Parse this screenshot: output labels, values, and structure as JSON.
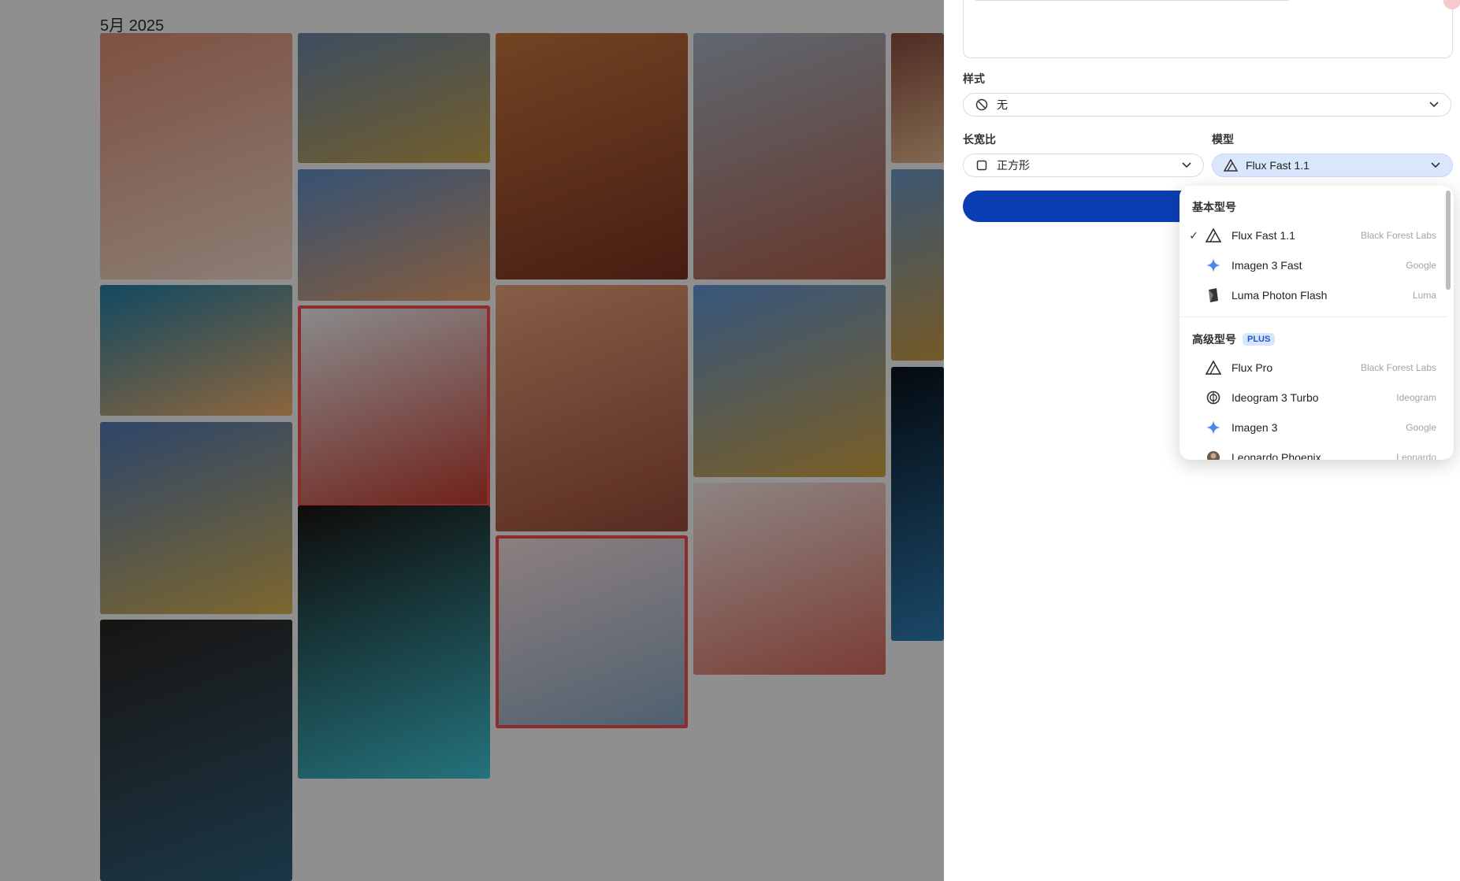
{
  "gallery": {
    "month_label": "5月 2025",
    "images": [
      {
        "id": "silk-passport",
        "colors": [
          "#d98c73",
          "#f0d9c8"
        ],
        "selected": false
      },
      {
        "id": "coastal-cliffs",
        "colors": [
          "#6a86a6",
          "#c6a34e"
        ],
        "selected": false
      },
      {
        "id": "red-train",
        "colors": [
          "#c5763d",
          "#7a3221"
        ],
        "selected": false
      },
      {
        "id": "church-street",
        "colors": [
          "#a4b3c2",
          "#b05e49"
        ],
        "selected": false
      },
      {
        "id": "pagoda-edge",
        "colors": [
          "#8a4b3f",
          "#e0b68a"
        ],
        "selected": false
      },
      {
        "id": "beach-sunset",
        "colors": [
          "#5d8ec6",
          "#e6a06b"
        ],
        "selected": false
      },
      {
        "id": "coral-reef",
        "colors": [
          "#1f7ea8",
          "#f2b06a"
        ],
        "selected": false
      },
      {
        "id": "portrait-woman-1",
        "colors": [
          "#eef1f4",
          "#c0392b"
        ],
        "selected": true
      },
      {
        "id": "eiffel-canyon",
        "colors": [
          "#e8a27a",
          "#9a4b3a"
        ],
        "selected": false
      },
      {
        "id": "savanna-sky",
        "colors": [
          "#5f95d6",
          "#d2a441"
        ],
        "selected": false
      },
      {
        "id": "field-hills",
        "colors": [
          "#4f79b6",
          "#d7b250"
        ],
        "selected": false
      },
      {
        "id": "portrait-woman-2",
        "colors": [
          "#f4dcdc",
          "#88a6c0"
        ],
        "selected": true
      },
      {
        "id": "portrait-woman-3",
        "colors": [
          "#f3e5e2",
          "#d46a5c"
        ],
        "selected": false
      },
      {
        "id": "ai-hologram",
        "colors": [
          "#1a1512",
          "#3fc6d6"
        ],
        "selected": false
      },
      {
        "id": "businessman",
        "colors": [
          "#2a2420",
          "#2f5f7a"
        ],
        "selected": false
      },
      {
        "id": "landscape-edge",
        "colors": [
          "#6a96c4",
          "#c89b45"
        ],
        "selected": false
      },
      {
        "id": "dark-blue-glow",
        "colors": [
          "#08121c",
          "#2e7db4"
        ],
        "selected": false
      }
    ]
  },
  "panel": {
    "style_label": "样式",
    "style_value": "无",
    "aspect_label": "长宽比",
    "aspect_value": "正方形",
    "model_label": "模型",
    "model_value": "Flux Fast 1.1"
  },
  "dropdown": {
    "basic_heading": "基本型号",
    "advanced_heading": "高级型号",
    "plus_badge": "PLUS",
    "basic_options": [
      {
        "name": "Flux Fast 1.1",
        "provider": "Black Forest Labs",
        "icon": "flux-icon",
        "checked": true
      },
      {
        "name": "Imagen 3 Fast",
        "provider": "Google",
        "icon": "imagen-sparkle-icon",
        "checked": false
      },
      {
        "name": "Luma Photon Flash",
        "provider": "Luma",
        "icon": "luma-icon",
        "checked": false
      }
    ],
    "advanced_options": [
      {
        "name": "Flux Pro",
        "provider": "Black Forest Labs",
        "icon": "flux-icon"
      },
      {
        "name": "Ideogram 3 Turbo",
        "provider": "Ideogram",
        "icon": "ideogram-icon"
      },
      {
        "name": "Imagen 3",
        "provider": "Google",
        "icon": "imagen-sparkle-icon"
      },
      {
        "name": "Leonardo Phoenix",
        "provider": "Leonardo",
        "icon": "leonardo-icon"
      }
    ]
  },
  "colors": {
    "accent_blue": "#0b3eb3",
    "selected_border": "#f44b4b",
    "model_select_bg": "#d9e6fb",
    "google_blue": "#4a86e8"
  }
}
